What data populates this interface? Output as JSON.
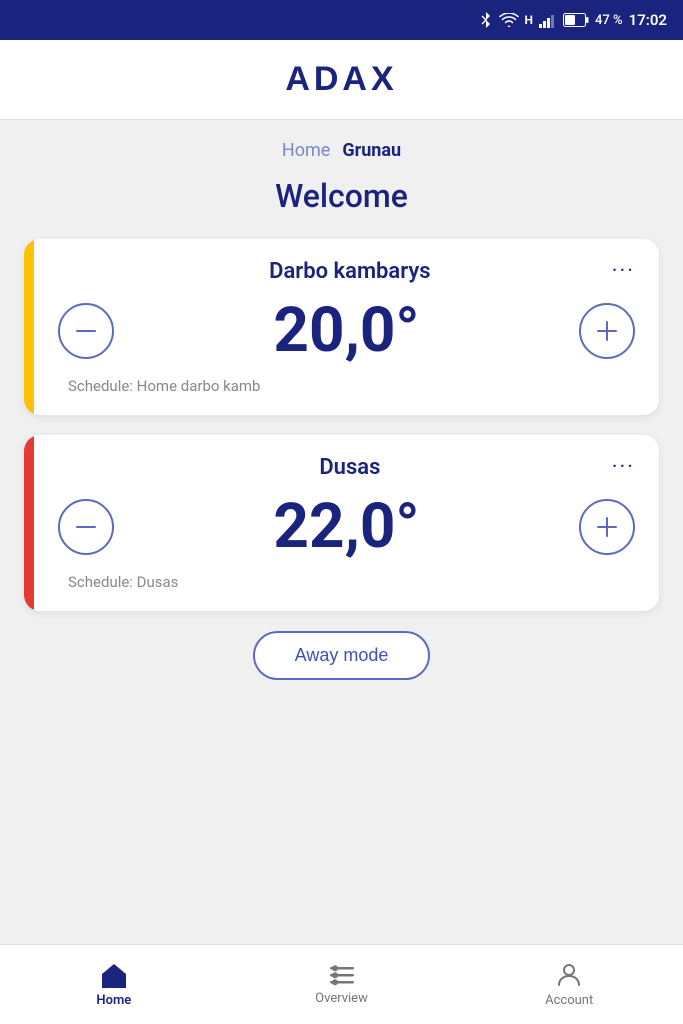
{
  "statusBar": {
    "battery": "47 %",
    "time": "17:02"
  },
  "header": {
    "logo": "ADAX"
  },
  "breadcrumb": {
    "home_label": "Home",
    "current_label": "Grunau"
  },
  "welcome": {
    "title": "Welcome"
  },
  "devices": [
    {
      "id": "darbo-kambarys",
      "name": "Darbo kambarys",
      "temperature": "20,0°",
      "schedule": "Schedule: Home darbo kamb",
      "indicator_color": "yellow"
    },
    {
      "id": "dusas",
      "name": "Dusas",
      "temperature": "22,0°",
      "schedule": "Schedule: Dusas",
      "indicator_color": "red"
    }
  ],
  "awayMode": {
    "label": "Away mode"
  },
  "bottomNav": [
    {
      "id": "home",
      "label": "Home",
      "active": true
    },
    {
      "id": "overview",
      "label": "Overview",
      "active": false
    },
    {
      "id": "account",
      "label": "Account",
      "active": false
    }
  ]
}
